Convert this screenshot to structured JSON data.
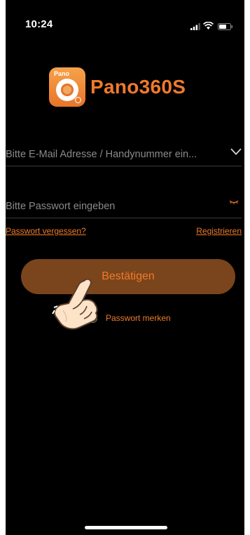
{
  "status_bar": {
    "time": "10:24"
  },
  "brand": {
    "icon_label": "Pano",
    "name": "Pano360S",
    "accent": "#f07a2a"
  },
  "login": {
    "email_placeholder": "Bitte E-Mail Adresse / Handynummer ein...",
    "password_placeholder": "Bitte Passwort eingeben",
    "forgot_label": "Passwort vergessen?",
    "register_label": "Registrieren",
    "confirm_label": "Bestätigen",
    "remember_label": "Passwort merken",
    "remember_checked": false
  },
  "icons": [
    "signal-icon",
    "wifi-icon",
    "battery-icon",
    "app-logo-icon",
    "chevron-down-icon",
    "eye-closed-icon",
    "pointing-hand-icon"
  ]
}
